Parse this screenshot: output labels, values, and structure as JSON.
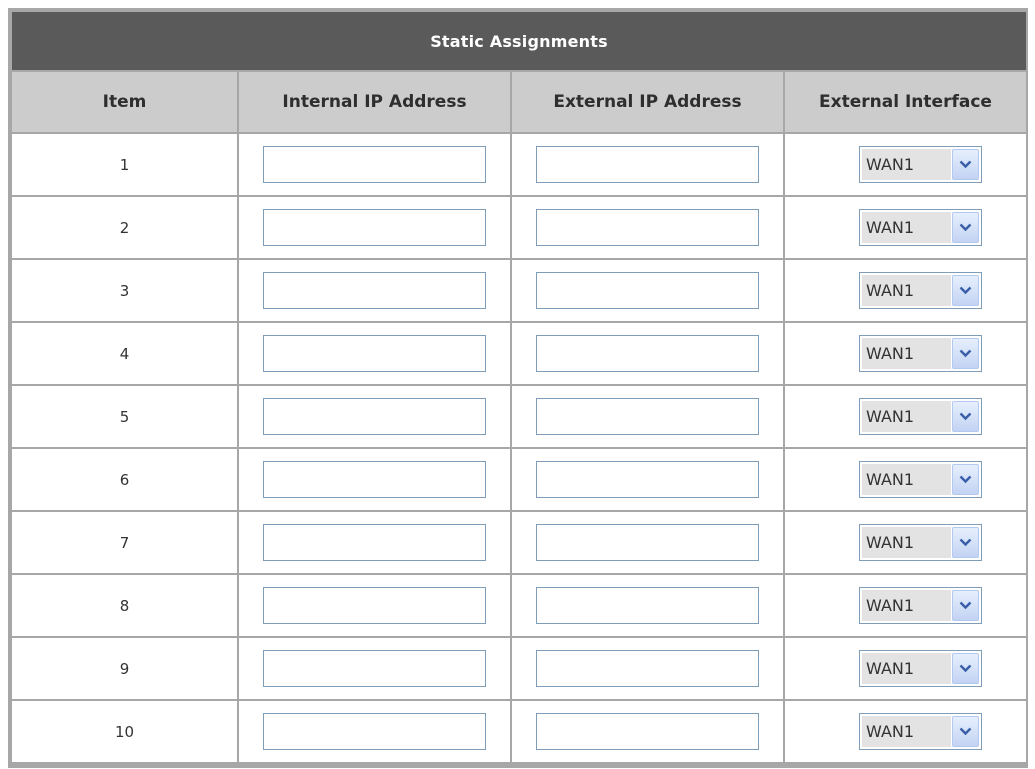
{
  "title": "Static Assignments",
  "columns": {
    "item": "Item",
    "internal_ip": "Internal IP Address",
    "external_ip": "External IP Address",
    "external_interface": "External Interface"
  },
  "rows": [
    {
      "item": "1",
      "internal_ip": "",
      "external_ip": "",
      "interface": "WAN1"
    },
    {
      "item": "2",
      "internal_ip": "",
      "external_ip": "",
      "interface": "WAN1"
    },
    {
      "item": "3",
      "internal_ip": "",
      "external_ip": "",
      "interface": "WAN1"
    },
    {
      "item": "4",
      "internal_ip": "",
      "external_ip": "",
      "interface": "WAN1"
    },
    {
      "item": "5",
      "internal_ip": "",
      "external_ip": "",
      "interface": "WAN1"
    },
    {
      "item": "6",
      "internal_ip": "",
      "external_ip": "",
      "interface": "WAN1"
    },
    {
      "item": "7",
      "internal_ip": "",
      "external_ip": "",
      "interface": "WAN1"
    },
    {
      "item": "8",
      "internal_ip": "",
      "external_ip": "",
      "interface": "WAN1"
    },
    {
      "item": "9",
      "internal_ip": "",
      "external_ip": "",
      "interface": "WAN1"
    },
    {
      "item": "10",
      "internal_ip": "",
      "external_ip": "",
      "interface": "WAN1"
    }
  ],
  "icons": {
    "dropdown": "chevron-down-icon"
  },
  "colors": {
    "title_bar": "#5a5a5a",
    "header_bar": "#cccccc",
    "grid": "#a7a7a7",
    "input_border": "#7f9db9",
    "select_button": "#c3d3f3"
  }
}
